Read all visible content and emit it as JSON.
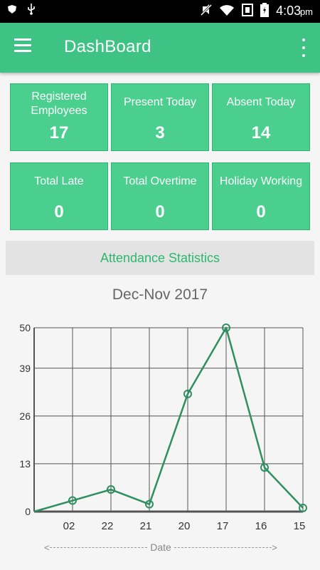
{
  "status_bar": {
    "time": "4:03",
    "ampm": "pm",
    "icons": [
      "shield-icon",
      "usb-icon",
      "mute-icon",
      "wifi-icon",
      "sim-icon",
      "battery-icon"
    ]
  },
  "app_bar": {
    "title": "DashBoard",
    "menu_icon": "hamburger-menu-icon",
    "overflow_icon": "overflow-menu-icon"
  },
  "stats": {
    "registered": {
      "label": "Registered Employees",
      "value": "17"
    },
    "present": {
      "label": "Present Today",
      "value": "3"
    },
    "absent": {
      "label": "Absent Today",
      "value": "14"
    },
    "late": {
      "label": "Total Late",
      "value": "0"
    },
    "overtime": {
      "label": "Total Overtime",
      "value": "0"
    },
    "holiday": {
      "label": "Holiday Working",
      "value": "0"
    }
  },
  "section": {
    "title": "Attendance Statistics"
  },
  "chart_data": {
    "type": "line",
    "title": "Dec-Nov 2017",
    "xlabel": "Date",
    "ylabel": "",
    "categories": [
      "02",
      "22",
      "21",
      "20",
      "17",
      "16",
      "15"
    ],
    "values": [
      3,
      6,
      2,
      32,
      50,
      12,
      1
    ],
    "y_ticks": [
      0,
      13,
      26,
      39,
      50
    ],
    "ylim": [
      0,
      50
    ],
    "grid": true,
    "line_color": "#2e8f60",
    "marker": "circle"
  },
  "colors": {
    "accent": "#3ec384",
    "tile": "#4acf8f",
    "section_text": "#2db76f"
  }
}
